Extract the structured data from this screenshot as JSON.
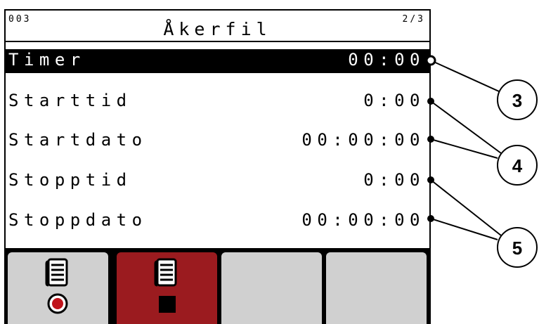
{
  "header": {
    "screen_code": "003",
    "title": "Åkerfil",
    "page_indicator": "2/3"
  },
  "rows": [
    {
      "label": "Timer",
      "value": "00:00",
      "selected": true
    },
    {
      "label": "Starttid",
      "value": "0:00",
      "selected": false
    },
    {
      "label": "Startdato",
      "value": "00:00:00",
      "selected": false
    },
    {
      "label": "Stopptid",
      "value": "0:00",
      "selected": false
    },
    {
      "label": "Stoppdato",
      "value": "00:00:00",
      "selected": false
    }
  ],
  "softkeys": [
    {
      "icon": "file-record-icon",
      "active": false
    },
    {
      "icon": "file-stop-icon",
      "active": true
    },
    {
      "icon": "",
      "active": false
    },
    {
      "icon": "",
      "active": false
    }
  ],
  "callouts": [
    "3",
    "4",
    "5"
  ],
  "colors": {
    "selected_row": "#000000",
    "active_softkey": "#9b1b1f",
    "inactive_softkey": "#d0d0d0",
    "record_dot": "#c0141c"
  }
}
